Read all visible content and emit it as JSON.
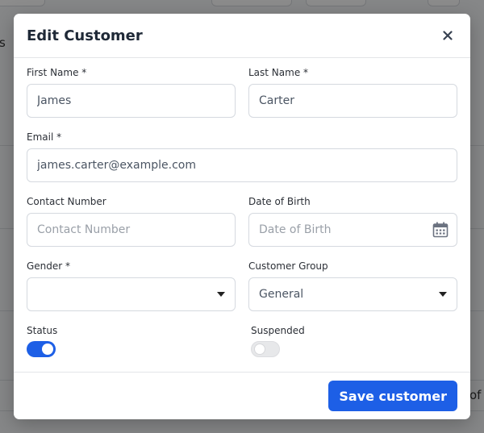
{
  "background": {
    "left_edge_text": "s",
    "right_edge_text": "of"
  },
  "modal": {
    "title": "Edit Customer",
    "close_icon": "close-icon",
    "fields": {
      "first_name": {
        "label": "First Name *",
        "value": "James",
        "placeholder": ""
      },
      "last_name": {
        "label": "Last Name *",
        "value": "Carter",
        "placeholder": ""
      },
      "email": {
        "label": "Email *",
        "value": "james.carter@example.com",
        "placeholder": ""
      },
      "contact_number": {
        "label": "Contact Number",
        "value": "",
        "placeholder": "Contact Number"
      },
      "date_of_birth": {
        "label": "Date of Birth",
        "value": "",
        "placeholder": "Date of Birth",
        "icon": "calendar-icon"
      },
      "gender": {
        "label": "Gender *",
        "value": ""
      },
      "customer_group": {
        "label": "Customer Group",
        "value": "General"
      }
    },
    "toggles": {
      "status": {
        "label": "Status",
        "on": true
      },
      "suspended": {
        "label": "Suspended",
        "on": false
      }
    },
    "footer": {
      "save_label": "Save customer"
    }
  },
  "colors": {
    "accent": "#1d5fe6",
    "toggle_off": "#e7e8ea"
  }
}
